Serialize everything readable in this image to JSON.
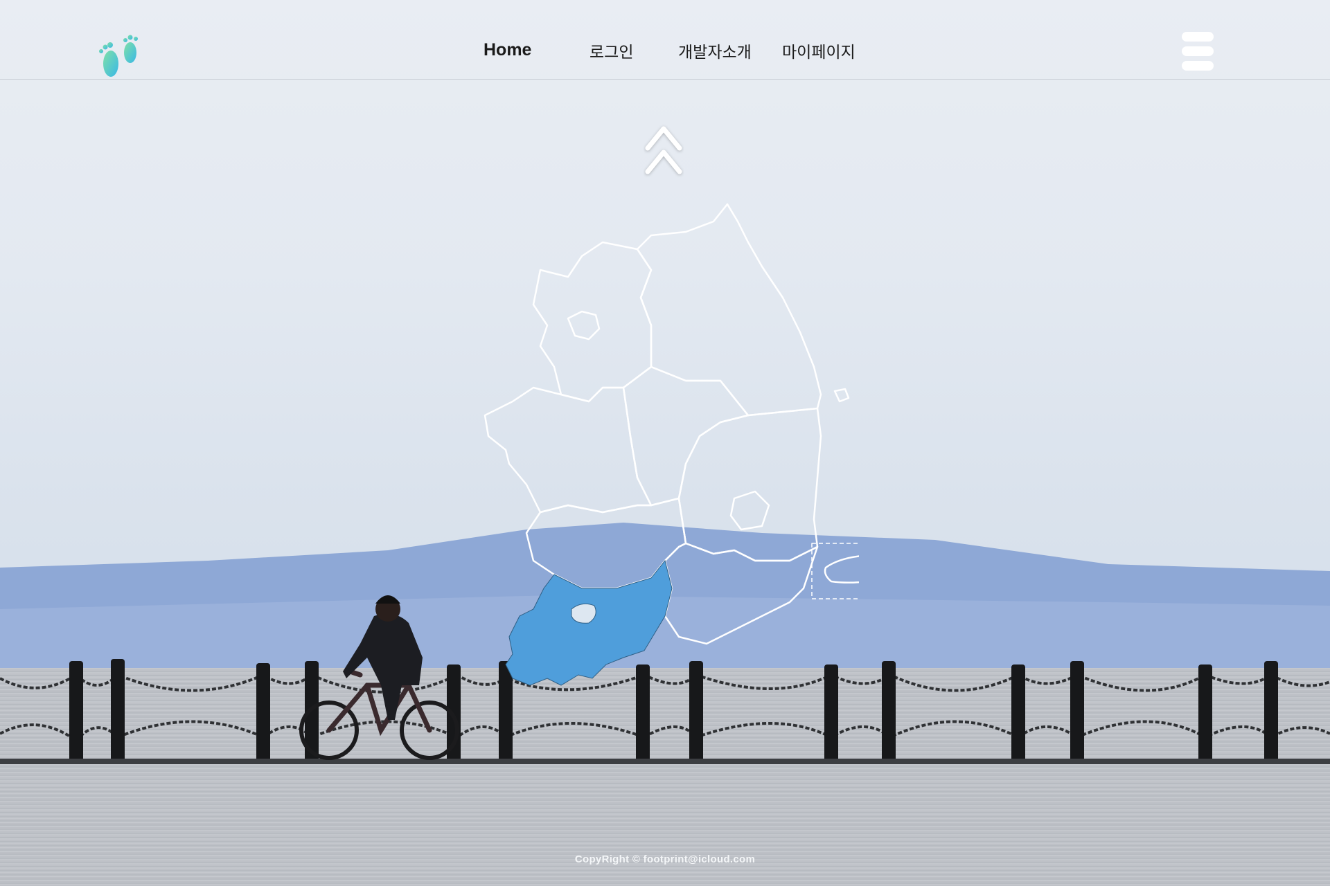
{
  "header": {
    "logo_icon": "footprints-icon",
    "nav": [
      {
        "label": "Home"
      },
      {
        "label": "로그인"
      },
      {
        "label": "개발자소개"
      },
      {
        "label": "마이페이지"
      }
    ],
    "menu_icon": "hamburger-menu-icon"
  },
  "scroll_icon": "double-chevron-up-icon",
  "map": {
    "highlighted_region_color": "#4f9edb",
    "outline_color": "#ffffff"
  },
  "footer": {
    "copyright": "CopyRight © footprint@icloud.com"
  }
}
